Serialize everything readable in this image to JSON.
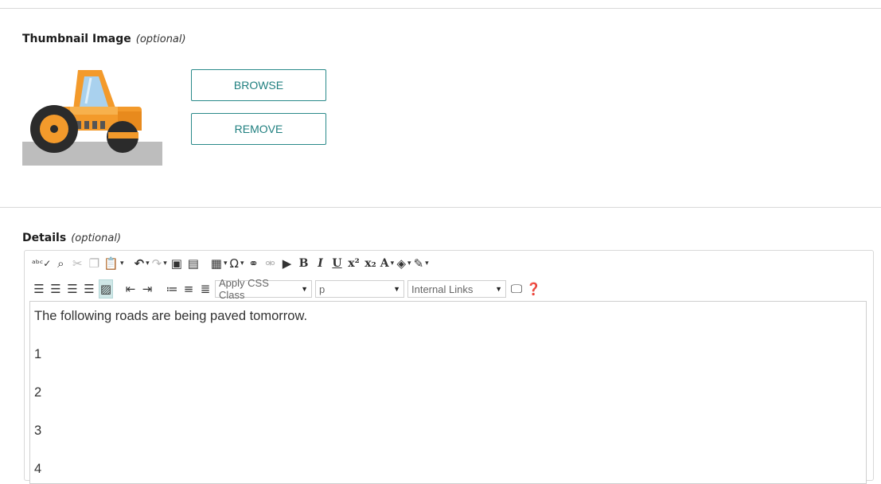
{
  "thumbnail": {
    "label": "Thumbnail Image",
    "optional": "(optional)",
    "image_alt": "road roller illustration",
    "browse_label": "BROWSE",
    "remove_label": "REMOVE"
  },
  "details": {
    "label": "Details",
    "optional": "(optional)",
    "toolbar": {
      "row1_icons": [
        "spellcheck-icon",
        "find-icon",
        "cut-icon",
        "copy-icon",
        "paste-icon",
        "undo-icon",
        "redo-icon",
        "image-manager-icon",
        "document-manager-icon",
        "table-icon",
        "symbol-icon",
        "link-icon",
        "unlink-icon",
        "media-icon",
        "bold-icon",
        "italic-icon",
        "underline-icon",
        "superscript-icon",
        "subscript-icon",
        "font-color-icon",
        "highlight-color-icon",
        "format-stripper-icon"
      ],
      "css_class_select": "Apply CSS Class",
      "paragraph_select": "p",
      "internal_links_select": "Internal Links"
    },
    "content": [
      "The following roads are being paved tomorrow.",
      "1",
      "2",
      "3",
      "4"
    ]
  },
  "colors": {
    "accent": "#1f7f7f",
    "border": "#d8d8d8"
  }
}
